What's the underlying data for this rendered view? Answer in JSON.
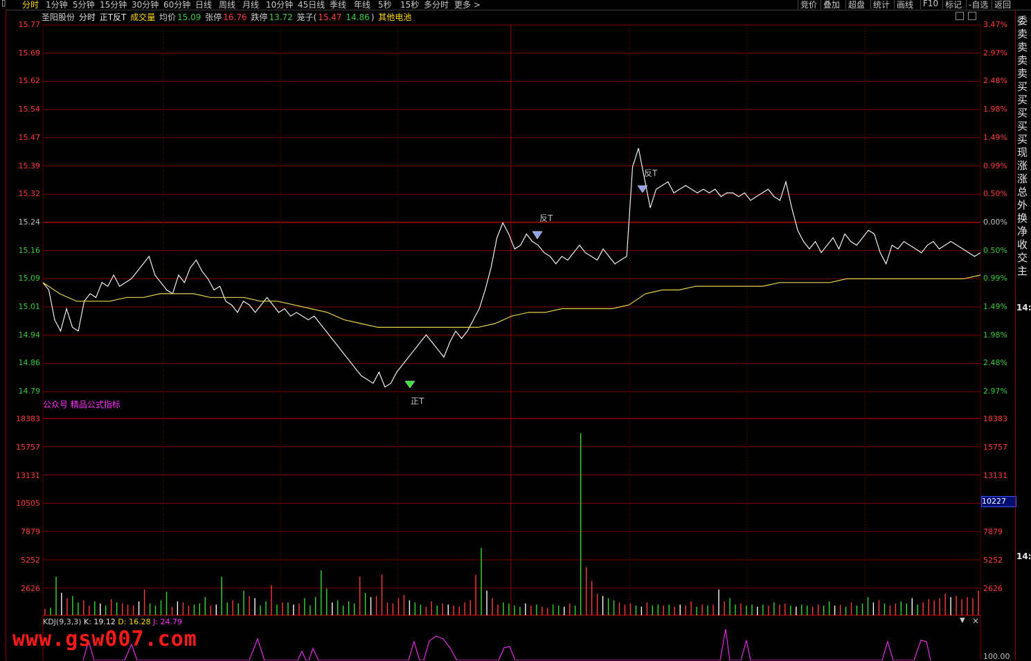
{
  "top_tabs": [
    {
      "label": "分时",
      "active": true
    },
    {
      "label": "1分钟"
    },
    {
      "label": "5分钟"
    },
    {
      "label": "15分钟"
    },
    {
      "label": "30分钟"
    },
    {
      "label": "60分钟"
    },
    {
      "label": "日线"
    },
    {
      "label": "周线"
    },
    {
      "label": "月线"
    },
    {
      "label": "10分钟"
    },
    {
      "label": "45日线"
    },
    {
      "label": "季线"
    },
    {
      "label": "年线"
    },
    {
      "label": "5秒"
    },
    {
      "label": "15秒"
    },
    {
      "label": "多分时"
    },
    {
      "label": "更多 >"
    }
  ],
  "right_tabs": [
    "竞价",
    "叠加",
    "超盘",
    "统计",
    "画线",
    "F10",
    "标记",
    "-自选",
    "返回"
  ],
  "info": {
    "stock_name": "圣阳股份",
    "mode": "分时",
    "indicator": "正T反T",
    "volume": "成交量",
    "avg_label": "均价",
    "avg_value": "15.09",
    "limit_up_label": "张停",
    "limit_up_value": "16.76",
    "limit_down_label": "跌停",
    "limit_down_value": "13.72",
    "lanzi_label": "笼子(",
    "lanzi_v1": "15.47",
    "lanzi_v2": "14.86",
    "lanzi_close": ")",
    "sector": "其他电池"
  },
  "price_axis": {
    "left": [
      "15.77",
      "15.69",
      "15.62",
      "15.54",
      "15.47",
      "15.39",
      "15.32",
      "15.24",
      "15.16",
      "15.09",
      "15.01",
      "14.94",
      "14.86",
      "14.79"
    ],
    "right": [
      "3.47%",
      "2.97%",
      "2.48%",
      "1.98%",
      "1.49%",
      "0.99%",
      "0.50%",
      "0.00%",
      "0.50%",
      "0.99%",
      "1.49%",
      "1.98%",
      "2.48%",
      "2.97%"
    ]
  },
  "volume_axis": {
    "left": [
      "18383",
      "15757",
      "13131",
      "10505",
      "7879",
      "5252",
      "2626"
    ],
    "right": [
      "18383",
      "15757",
      "13131",
      "",
      "7879",
      "5252",
      "2626"
    ]
  },
  "cursor_value": "10227",
  "signals": [
    {
      "text": "反T",
      "color": "#33dd33"
    },
    {
      "text": "反T",
      "color": "#33dd33"
    },
    {
      "text": "正T",
      "color": "#ff3333"
    }
  ],
  "public_text": "公众号 精品公式指标",
  "kdj": {
    "name": "KDJ(9,3,3)",
    "k": "K: 19.12",
    "d": "D: 16.28",
    "j": "J: 24.79",
    "bottom_label": "100.00"
  },
  "watermark": "www.gsw007.com",
  "right_panel": [
    "委",
    "卖",
    "卖",
    "卖",
    "卖",
    "买",
    "买",
    "买",
    "买",
    "买",
    "现",
    "涨",
    "涨",
    "总",
    "外",
    "换",
    "净",
    "收",
    "交",
    "主"
  ],
  "times": [
    "14:",
    "14:"
  ],
  "chart_data": {
    "type": "line",
    "title": "",
    "xlabel": "",
    "ylabel": "",
    "ylim": [
      14.79,
      15.77
    ],
    "series": [
      {
        "values": [
          15.08,
          15.06,
          14.98,
          14.95,
          15.01,
          14.96,
          14.95,
          15.03,
          15.05,
          15.04,
          15.08,
          15.07,
          15.1,
          15.07,
          15.08,
          15.09,
          15.11,
          15.13,
          15.15,
          15.1,
          15.08,
          15.06,
          15.05,
          15.1,
          15.08,
          15.12,
          15.14,
          15.11,
          15.09,
          15.06,
          15.07,
          15.03,
          15.02,
          15.0,
          15.03,
          15.02,
          15.0,
          15.02,
          15.04,
          15.02,
          15.0,
          15.01,
          14.99,
          15.0,
          14.99,
          14.98,
          14.99,
          14.97,
          14.95,
          14.93,
          14.91,
          14.89,
          14.87,
          14.85,
          14.83,
          14.82,
          14.81,
          14.84,
          14.8,
          14.81,
          14.84,
          14.86,
          14.88,
          14.9,
          14.92,
          14.94,
          14.92,
          14.9,
          14.88,
          14.92,
          14.95,
          14.93,
          14.95,
          14.98,
          15.01,
          15.06,
          15.12,
          15.2,
          15.24,
          15.21,
          15.17,
          15.18,
          15.21,
          15.19,
          15.18,
          15.16,
          15.15,
          15.13,
          15.15,
          15.14,
          15.16,
          15.18,
          15.16,
          15.15,
          15.14,
          15.17,
          15.15,
          15.13,
          15.14,
          15.15,
          15.39,
          15.44,
          15.36,
          15.28,
          15.33,
          15.34,
          15.35,
          15.32,
          15.33,
          15.34,
          15.33,
          15.32,
          15.33,
          15.32,
          15.33,
          15.31,
          15.32,
          15.32,
          15.31,
          15.32,
          15.3,
          15.31,
          15.32,
          15.33,
          15.31,
          15.3,
          15.35,
          15.28,
          15.22,
          15.19,
          15.17,
          15.19,
          15.16,
          15.18,
          15.2,
          15.17,
          15.21,
          15.19,
          15.18,
          15.2,
          15.22,
          15.21,
          15.16,
          15.13,
          15.18,
          15.17,
          15.19,
          15.18,
          15.17,
          15.16,
          15.18,
          15.19,
          15.17,
          15.18,
          15.19,
          15.18,
          15.17,
          15.16,
          15.15,
          15.16
        ]
      },
      {
        "values": [
          15.08,
          15.05,
          15.03,
          15.03,
          15.03,
          15.04,
          15.04,
          15.05,
          15.05,
          15.05,
          15.04,
          15.04,
          15.04,
          15.03,
          15.03,
          15.02,
          15.01,
          15.0,
          14.98,
          14.97,
          14.96,
          14.96,
          14.96,
          14.96,
          14.96,
          14.96,
          14.96,
          14.97,
          14.99,
          15.0,
          15.0,
          15.01,
          15.01,
          15.01,
          15.01,
          15.02,
          15.05,
          15.06,
          15.06,
          15.07,
          15.07,
          15.07,
          15.07,
          15.07,
          15.08,
          15.08,
          15.08,
          15.08,
          15.09,
          15.09,
          15.09,
          15.09,
          15.09,
          15.09,
          15.09,
          15.09,
          15.1
        ]
      }
    ],
    "volume_values": [
      600,
      700,
      3600,
      2100,
      1600,
      1800,
      1200,
      1400,
      900,
      1300,
      1100,
      900,
      1500,
      1200,
      1100,
      1000,
      900,
      1300,
      2400,
      1100,
      900,
      1400,
      2200,
      800,
      1300,
      1200,
      900,
      1000,
      1100,
      1700,
      900,
      1000,
      3600,
      1200,
      1400,
      1100,
      2300,
      1800,
      1600,
      900,
      1300,
      2800,
      1000,
      1200,
      1200,
      1000,
      1100,
      1600,
      900,
      1700,
      4200,
      2500,
      1200,
      1400,
      900,
      1300,
      1100,
      3600,
      2100,
      1700,
      1800,
      3800,
      1200,
      1100,
      1600,
      1900,
      1400,
      1200,
      1000,
      800,
      1300,
      900,
      1100,
      1000,
      900,
      800,
      1200,
      1400,
      3800,
      6300,
      2300,
      1600,
      1000,
      1200,
      1100,
      900,
      800,
      1100,
      900,
      1000,
      800,
      700,
      1000,
      900,
      800,
      1100,
      900,
      17000,
      4500,
      3200,
      2000,
      1800,
      1600,
      1400,
      1200,
      1000,
      1100,
      900,
      800,
      1200,
      900,
      1000,
      900,
      1000,
      800,
      1000,
      900,
      1300,
      800,
      1000,
      900,
      1000,
      2400,
      1300,
      1600,
      1000,
      1100,
      900,
      1000,
      800,
      1000,
      900,
      1200,
      1000,
      1100,
      900,
      800,
      1000,
      900,
      800,
      1000,
      900,
      1300,
      900,
      1000,
      800,
      1200,
      900,
      1100,
      1700,
      1200,
      1400,
      1100,
      900,
      1100,
      1300,
      1100,
      1600,
      1000,
      1200,
      1500,
      1400,
      1600,
      2000,
      1700,
      1800,
      1500,
      1700,
      1600,
      2300
    ]
  }
}
